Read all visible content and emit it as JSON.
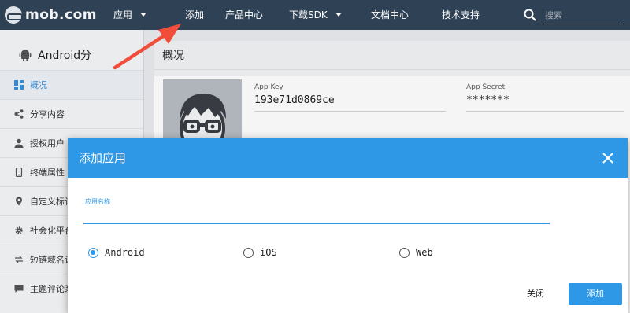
{
  "nav": {
    "logo_text": "mob.com",
    "items": [
      {
        "label": "应用",
        "dropdown": true
      },
      {
        "label": "添加",
        "dropdown": false
      },
      {
        "label": "产品中心",
        "dropdown": false
      },
      {
        "label": "下载SDK",
        "dropdown": true
      },
      {
        "label": "文档中心",
        "dropdown": false
      },
      {
        "label": "技术支持",
        "dropdown": false
      }
    ],
    "search_placeholder": "搜索"
  },
  "sidebar": {
    "title": "Android分",
    "items": [
      {
        "label": "概况",
        "icon": "dashboard-icon",
        "active": true
      },
      {
        "label": "分享内容",
        "icon": "share-icon",
        "active": false
      },
      {
        "label": "授权用户",
        "icon": "user-icon",
        "active": false
      },
      {
        "label": "终端属性",
        "icon": "phone-icon",
        "active": false
      },
      {
        "label": "自定义标记",
        "icon": "pin-icon",
        "active": false
      },
      {
        "label": "社会化平台",
        "icon": "gear-icon",
        "active": false
      },
      {
        "label": "短链域名设",
        "icon": "link-icon",
        "active": false
      },
      {
        "label": "主题评论系",
        "icon": "comment-icon",
        "active": false
      }
    ]
  },
  "main": {
    "title": "概况",
    "app_key_label": "App Key",
    "app_key_value": "193e71d0869ce",
    "app_secret_label": "App Secret",
    "app_secret_value": "*******"
  },
  "dialog": {
    "title": "添加应用",
    "field_label": "应用名称",
    "field_value": "",
    "platforms": [
      {
        "label": "Android",
        "checked": true
      },
      {
        "label": "iOS",
        "checked": false
      },
      {
        "label": "Web",
        "checked": false
      }
    ],
    "close_label": "关闭",
    "submit_label": "添加"
  },
  "colors": {
    "navbar": "#2f4255",
    "accent": "#2e98e6",
    "arrow": "#f04e3a"
  }
}
